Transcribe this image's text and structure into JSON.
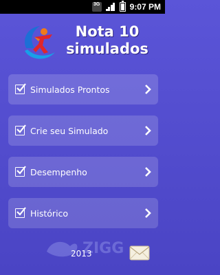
{
  "status_bar": {
    "network": "3G",
    "time": "9:07 PM"
  },
  "logo": {
    "line1": "Nota 10",
    "line2": "simulados"
  },
  "menu": {
    "items": [
      {
        "label": "Simulados Prontos"
      },
      {
        "label": "Crie seu Simulado"
      },
      {
        "label": "Desempenho"
      },
      {
        "label": "Histórico"
      }
    ]
  },
  "footer": {
    "year": "2013",
    "watermark": "ZIGG"
  },
  "colors": {
    "background": "#5b55d8",
    "menu_item": "rgba(255,255,255,0.16)",
    "logo_orange": "#f07a1a",
    "logo_red": "#e0262a",
    "logo_blue": "#1d6fd6"
  }
}
